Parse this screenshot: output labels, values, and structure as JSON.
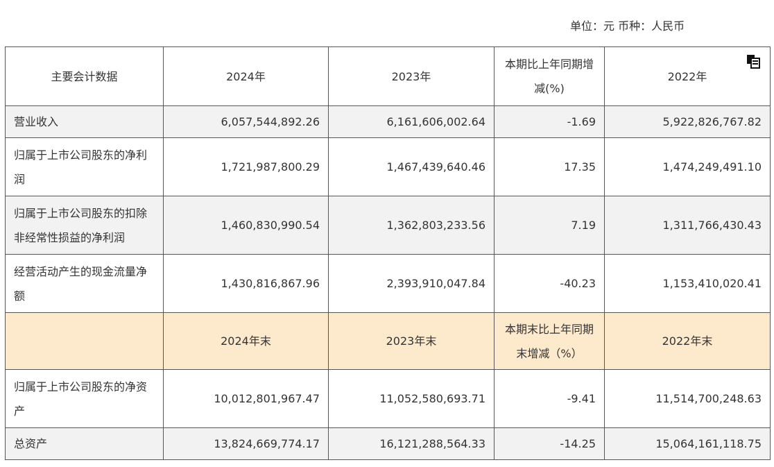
{
  "unit_text": "单位：元 币种：人民币",
  "icons": {
    "copy": "copy-icon"
  },
  "table": {
    "header": [
      "主要会计数据",
      "2024年",
      "2023年",
      "本期比上年同期增减(%)",
      "2022年"
    ],
    "rows_flow": [
      {
        "label": "营业收入",
        "v2024": "6,057,544,892.26",
        "v2023": "6,161,606,002.64",
        "change": "-1.69",
        "v2022": "5,922,826,767.82"
      },
      {
        "label": "归属于上市公司股东的净利润",
        "v2024": "1,721,987,800.29",
        "v2023": "1,467,439,640.46",
        "change": "17.35",
        "v2022": "1,474,249,491.10"
      },
      {
        "label": "归属于上市公司股东的扣除非经常性损益的净利润",
        "v2024": "1,460,830,990.54",
        "v2023": "1,362,803,233.56",
        "change": "7.19",
        "v2022": "1,311,766,430.43"
      },
      {
        "label": "经营活动产生的现金流量净额",
        "v2024": "1,430,816,867.96",
        "v2023": "2,393,910,047.84",
        "change": "-40.23",
        "v2022": "1,153,410,020.41"
      }
    ],
    "subheader": [
      "",
      "2024年末",
      "2023年末",
      "本期末比上年同期末增减（%）",
      "2022年末"
    ],
    "rows_stock": [
      {
        "label": "归属于上市公司股东的净资产",
        "v2024": "10,012,801,967.47",
        "v2023": "11,052,580,693.71",
        "change": "-9.41",
        "v2022": "11,514,700,248.63"
      },
      {
        "label": "总资产",
        "v2024": "13,824,669,774.17",
        "v2023": "16,121,288,564.33",
        "change": "-14.25",
        "v2022": "15,064,161,118.75"
      }
    ]
  }
}
